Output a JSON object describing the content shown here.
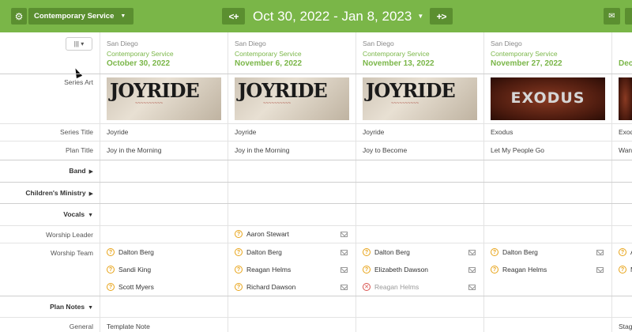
{
  "toolbar": {
    "service_name": "Contemporary Service",
    "date_range": "Oct 30, 2022 - Jan 8, 2023",
    "prev_label": "<+",
    "next_label": "+>"
  },
  "row_labels": {
    "series_art": "Series Art",
    "series_title": "Series Title",
    "plan_title": "Plan Title",
    "band": "Band",
    "childrens_ministry": "Children's Ministry",
    "vocals": "Vocals",
    "worship_leader": "Worship Leader",
    "worship_team": "Worship Team",
    "plan_notes": "Plan Notes",
    "general": "General"
  },
  "plans": [
    {
      "campus": "San Diego",
      "service": "Contemporary Service",
      "date": "October 30, 2022",
      "series_art": "JOYRIDE",
      "series_title": "Joyride",
      "plan_title": "Joy in the Morning",
      "worship_leader": "",
      "worship_team": [
        {
          "name": "Dalton Berg",
          "status": "unconfirmed"
        },
        {
          "name": "Sandi King",
          "status": "unconfirmed"
        },
        {
          "name": "Scott Myers",
          "status": "unconfirmed"
        }
      ],
      "general_note": "Template Note"
    },
    {
      "campus": "San Diego",
      "service": "Contemporary Service",
      "date": "November 6, 2022",
      "series_art": "JOYRIDE",
      "series_title": "Joyride",
      "plan_title": "Joy in the Morning",
      "worship_leader": "Aaron Stewart",
      "worship_team": [
        {
          "name": "Dalton Berg",
          "status": "unconfirmed"
        },
        {
          "name": "Reagan Helms",
          "status": "unconfirmed"
        },
        {
          "name": "Richard Dawson",
          "status": "unconfirmed"
        }
      ],
      "general_note": ""
    },
    {
      "campus": "San Diego",
      "service": "Contemporary Service",
      "date": "November 13, 2022",
      "series_art": "JOYRIDE",
      "series_title": "Joyride",
      "plan_title": "Joy to Become",
      "worship_leader": "",
      "worship_team": [
        {
          "name": "Dalton Berg",
          "status": "unconfirmed"
        },
        {
          "name": "Elizabeth Dawson",
          "status": "unconfirmed"
        },
        {
          "name": "Reagan Helms",
          "status": "declined"
        }
      ],
      "general_note": ""
    },
    {
      "campus": "San Diego",
      "service": "Contemporary Service",
      "date": "November 27, 2022",
      "series_art": "EXODUS",
      "series_title": "Exodus",
      "plan_title": "Let My People Go",
      "worship_leader": "",
      "worship_team": [
        {
          "name": "Dalton Berg",
          "status": "unconfirmed"
        },
        {
          "name": "Reagan Helms",
          "status": "unconfirmed"
        }
      ],
      "general_note": ""
    },
    {
      "campus": "",
      "service": "",
      "date": "Dec",
      "series_art": "",
      "series_title": "Exod",
      "plan_title": "Wan",
      "worship_leader": "",
      "worship_team": [
        {
          "name": "A",
          "status": "unconfirmed"
        },
        {
          "name": "M",
          "status": "unconfirmed"
        }
      ],
      "general_note": "Stag"
    }
  ],
  "icons": {
    "gear": "gear-icon",
    "caret": "chevron-down-icon",
    "mail": "envelope-icon",
    "columns": "columns-icon",
    "unconfirmed": "question-circle-icon",
    "declined": "x-circle-icon"
  },
  "colors": {
    "brand_green": "#7ab648",
    "dark_green": "#5b8f30",
    "unconfirmed": "#e8a317",
    "declined": "#d9534f"
  }
}
